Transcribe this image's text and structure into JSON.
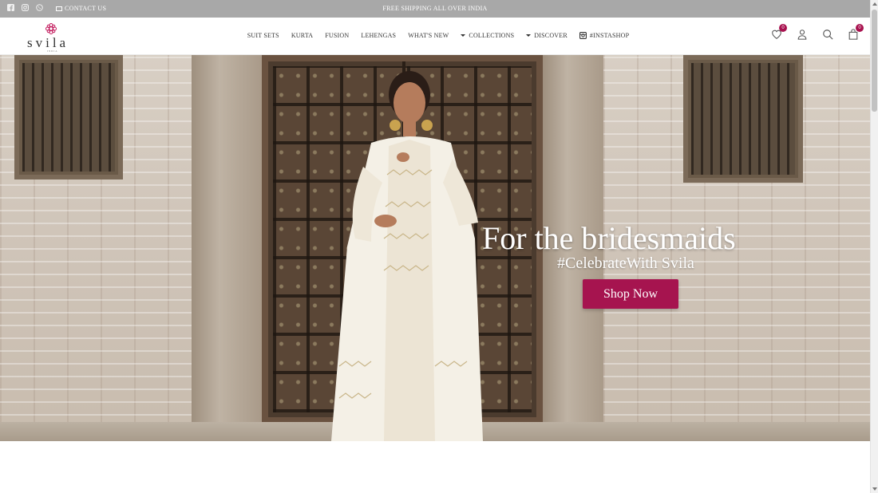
{
  "topbar": {
    "social_icons": [
      "facebook-icon",
      "instagram-icon",
      "whatsapp-icon"
    ],
    "contact_label": "CONTACT US",
    "promo": "FREE SHIPPING ALL OVER INDIA"
  },
  "header": {
    "logo_text": "svila",
    "logo_sub": "INDIA",
    "nav": [
      {
        "label": "SUIT SETS",
        "has_dropdown": false
      },
      {
        "label": "KURTA",
        "has_dropdown": false
      },
      {
        "label": "FUSION",
        "has_dropdown": false
      },
      {
        "label": "LEHENGAS",
        "has_dropdown": false
      },
      {
        "label": "WHAT'S NEW",
        "has_dropdown": false
      },
      {
        "label": "COLLECTIONS",
        "has_dropdown": true
      },
      {
        "label": "DISCOVER",
        "has_dropdown": true
      },
      {
        "label": "#INSTASHOP",
        "has_dropdown": false,
        "icon": "instagram-icon"
      }
    ],
    "icons": {
      "wishlist_count": "0",
      "cart_count": "0"
    }
  },
  "hero": {
    "headline": "For the bridesmaids",
    "tagline": "#CelebrateWith Svila",
    "cta_label": "Shop Now"
  },
  "colors": {
    "accent": "#a6144f",
    "topbar_bg": "#a8a8a8"
  }
}
